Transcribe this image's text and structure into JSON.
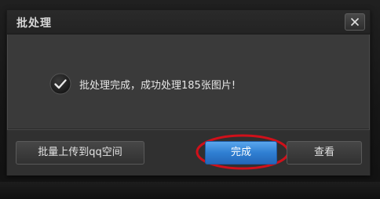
{
  "dialog": {
    "title": "批处理",
    "close_icon": "close-icon"
  },
  "content": {
    "status_icon": "checkmark-circle-icon",
    "message": "批处理完成，成功处理185张图片!"
  },
  "footer": {
    "upload_label": "批量上传到qq空间",
    "done_label": "完成",
    "view_label": "查看"
  },
  "colors": {
    "dialog_bg": "#3a3a3a",
    "titlebar_bg": "#252525",
    "primary_button": "#2f7fd2",
    "highlight_ring": "#d0101a"
  }
}
